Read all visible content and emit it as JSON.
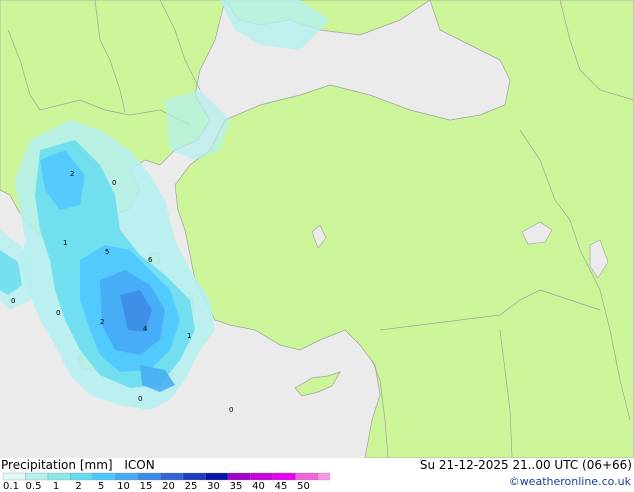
{
  "title": "Precipitation [mm]",
  "model": "ICON",
  "valid_time": "Su 21-12-2025 21..00 UTC (06+66)",
  "credit": "©weatheronline.co.uk",
  "legend": {
    "ticks": [
      "0.1",
      "0.5",
      "1",
      "2",
      "5",
      "10",
      "15",
      "20",
      "25",
      "30",
      "35",
      "40",
      "45",
      "50"
    ],
    "colors": [
      "#e0fafa",
      "#b4f0f0",
      "#8ce6e6",
      "#64dcf0",
      "#50c8ff",
      "#46aaf5",
      "#3c8ce6",
      "#3264d2",
      "#1e3cbe",
      "#0a14aa",
      "#a000c8",
      "#c800dc",
      "#e600f0",
      "#f064dc",
      "#fa96e6"
    ]
  },
  "map_labels": [
    "2",
    "0",
    "1",
    "5",
    "6",
    "0",
    "2",
    "4",
    "1",
    "0",
    "0",
    "0"
  ],
  "colors": {
    "land": "#ccf59a",
    "sea": "#ebebeb",
    "border": "#a0a0a0"
  }
}
